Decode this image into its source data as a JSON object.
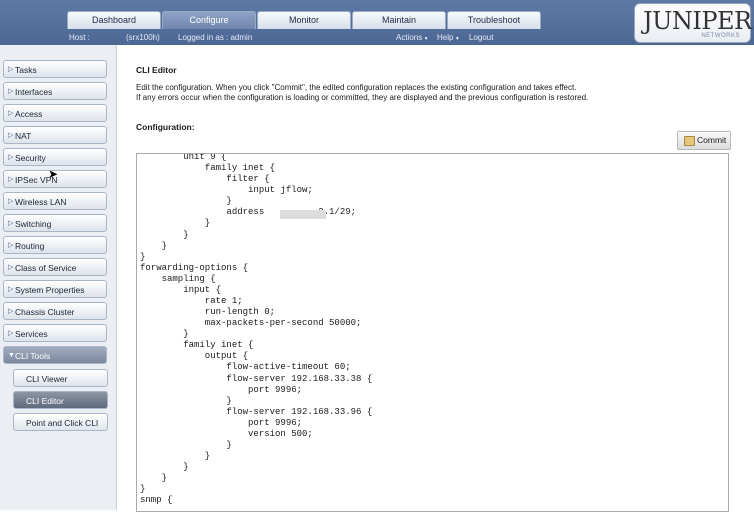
{
  "tabs": [
    "Dashboard",
    "Configure",
    "Monitor",
    "Maintain",
    "Troubleshoot"
  ],
  "logo": {
    "text": "JUNIPER",
    "sub": "NETWORKS"
  },
  "infobar": {
    "host_label": "Host :",
    "host_value": "(srx100h)",
    "logged_in": "Logged in as : admin",
    "actions": "Actions",
    "help": "Help",
    "logout": "Logout"
  },
  "sidebar": {
    "items": [
      "Tasks",
      "Interfaces",
      "Access",
      "NAT",
      "Security",
      "IPSec VPN",
      "Wireless LAN",
      "Switching",
      "Routing",
      "Class of Service",
      "System Properties",
      "Chassis Cluster",
      "Services",
      "CLI Tools"
    ],
    "sub_items": [
      "CLI Viewer",
      "CLI Editor",
      "Point and Click CLI"
    ]
  },
  "main": {
    "title": "CLI Editor",
    "desc_line1": "Edit the configuration. When you click \"Commit\", the edited configuration replaces the existing configuration and takes effect.",
    "desc_line2": "If any errors occur when the configuration is loading or committed, they are displayed and the previous configuration is restored.",
    "config_label": "Configuration:",
    "commit_label": "Commit",
    "config_text": "        unit 9 {\n            family inet {\n                filter {\n                    input jflow;\n                }\n                address          2.1/29;\n            }\n        }\n    }\n}\nforwarding-options {\n    sampling {\n        input {\n            rate 1;\n            run-length 0;\n            max-packets-per-second 50000;\n        }\n        family inet {\n            output {\n                flow-active-timeout 60;\n                flow-server 192.168.33.38 {\n                    port 9996;\n                }\n                flow-server 192.168.33.96 {\n                    port 9996;\n                    version 500;\n                }\n            }\n        }\n    }\n}\nsnmp {"
  },
  "colors": {
    "header": "#5f79a6",
    "active_tab": "#7f94b8",
    "sidebar_bg": "#ebeef2",
    "sub_active": "#6b7588"
  }
}
